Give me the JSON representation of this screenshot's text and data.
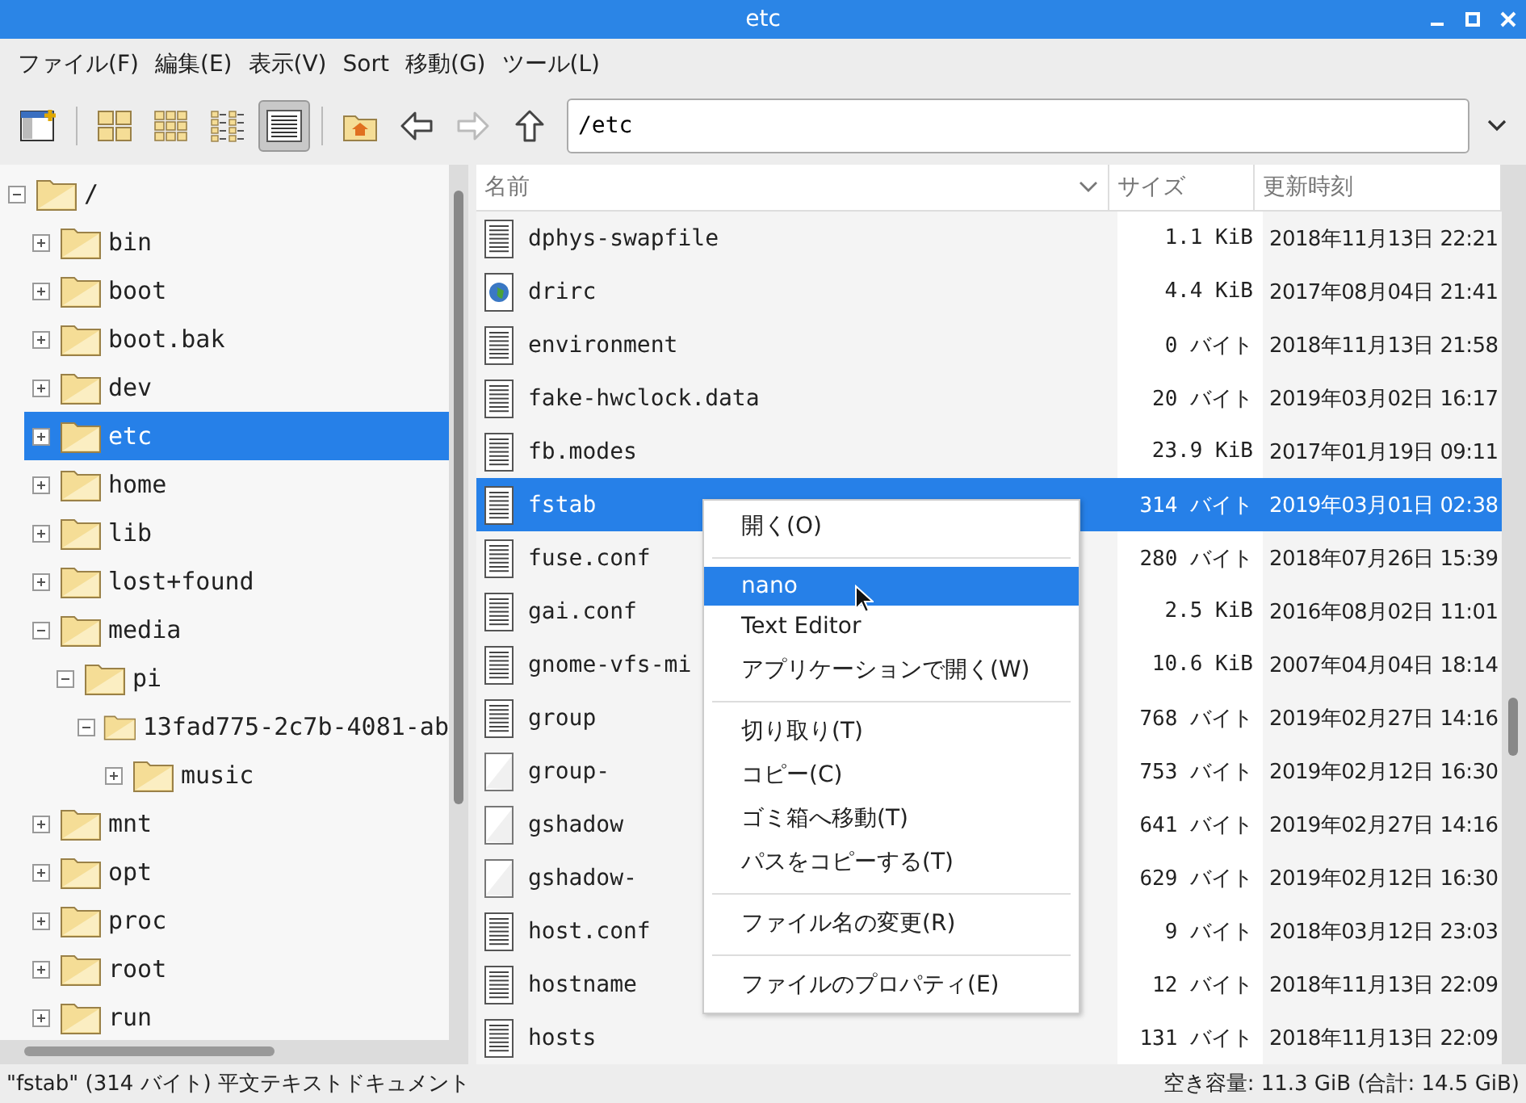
{
  "window": {
    "title": "etc"
  },
  "menu": [
    "ファイル(F)",
    "編集(E)",
    "表示(V)",
    "Sort",
    "移動(G)",
    "ツール(L)"
  ],
  "toolbar": {
    "views": [
      {
        "kind": "icons",
        "selected": false
      },
      {
        "kind": "thumbnails",
        "selected": false
      },
      {
        "kind": "compact",
        "selected": false
      },
      {
        "kind": "detail",
        "selected": true
      }
    ],
    "forward_disabled": true,
    "path": "/etc"
  },
  "tree": [
    {
      "label": "/",
      "expanded": true,
      "selected": false,
      "children": [
        {
          "label": "bin",
          "expanded": false,
          "selected": false
        },
        {
          "label": "boot",
          "expanded": false,
          "selected": false
        },
        {
          "label": "boot.bak",
          "expanded": false,
          "selected": false
        },
        {
          "label": "dev",
          "expanded": false,
          "selected": false
        },
        {
          "label": "etc",
          "expanded": false,
          "selected": true
        },
        {
          "label": "home",
          "expanded": false,
          "selected": false
        },
        {
          "label": "lib",
          "expanded": false,
          "selected": false
        },
        {
          "label": "lost+found",
          "expanded": false,
          "selected": false
        },
        {
          "label": "media",
          "expanded": true,
          "selected": false,
          "children": [
            {
              "label": "pi",
              "expanded": true,
              "selected": false,
              "children": [
                {
                  "label": "13fad775-2c7b-4081-ab",
                  "expanded": true,
                  "selected": false,
                  "children": [
                    {
                      "label": "music",
                      "expanded": false,
                      "selected": false
                    }
                  ]
                }
              ]
            }
          ]
        },
        {
          "label": "mnt",
          "expanded": false,
          "selected": false
        },
        {
          "label": "opt",
          "expanded": false,
          "selected": false
        },
        {
          "label": "proc",
          "expanded": false,
          "selected": false
        },
        {
          "label": "root",
          "expanded": false,
          "selected": false
        },
        {
          "label": "run",
          "expanded": false,
          "selected": false
        }
      ]
    }
  ],
  "table": {
    "columns": [
      "名前",
      "サイズ",
      "更新時刻"
    ],
    "rows": [
      {
        "kind": "text",
        "name": "dphys-swapfile",
        "size": "1.1 KiB",
        "modified": "2018年11月13日 22:21",
        "selected": false
      },
      {
        "kind": "globe",
        "name": "drirc",
        "size": "4.4 KiB",
        "modified": "2017年08月04日 21:41",
        "selected": false
      },
      {
        "kind": "text",
        "name": "environment",
        "size": "0 バイト",
        "modified": "2018年11月13日 21:58",
        "selected": false
      },
      {
        "kind": "text",
        "name": "fake-hwclock.data",
        "size": "20 バイト",
        "modified": "2019年03月02日 16:17",
        "selected": false
      },
      {
        "kind": "text",
        "name": "fb.modes",
        "size": "23.9 KiB",
        "modified": "2017年01月19日 09:11",
        "selected": false
      },
      {
        "kind": "text",
        "name": "fstab",
        "size": "314 バイト",
        "modified": "2019年03月01日 02:38",
        "selected": true
      },
      {
        "kind": "text",
        "name": "fuse.conf",
        "size": "280 バイト",
        "modified": "2018年07月26日 15:39",
        "selected": false
      },
      {
        "kind": "text",
        "name": "gai.conf",
        "size": "2.5 KiB",
        "modified": "2016年08月02日 11:01",
        "selected": false
      },
      {
        "kind": "text",
        "name": "gnome-vfs-mi",
        "size": "10.6 KiB",
        "modified": "2007年04月04日 18:14",
        "selected": false
      },
      {
        "kind": "text",
        "name": "group",
        "size": "768 バイト",
        "modified": "2019年02月27日 14:16",
        "selected": false
      },
      {
        "kind": "blank",
        "name": "group-",
        "size": "753 バイト",
        "modified": "2019年02月12日 16:30",
        "selected": false
      },
      {
        "kind": "blank",
        "name": "gshadow",
        "size": "641 バイト",
        "modified": "2019年02月27日 14:16",
        "selected": false
      },
      {
        "kind": "blank",
        "name": "gshadow-",
        "size": "629 バイト",
        "modified": "2019年02月12日 16:30",
        "selected": false
      },
      {
        "kind": "text",
        "name": "host.conf",
        "size": "9 バイト",
        "modified": "2018年03月12日 23:03",
        "selected": false
      },
      {
        "kind": "text",
        "name": "hostname",
        "size": "12 バイト",
        "modified": "2018年11月13日 22:09",
        "selected": false
      },
      {
        "kind": "text",
        "name": "hosts",
        "size": "131 バイト",
        "modified": "2018年11月13日 22:09",
        "selected": false
      }
    ]
  },
  "context_menu": [
    {
      "kind": "item",
      "label": "開く(O)",
      "selected": false
    },
    {
      "kind": "separator"
    },
    {
      "kind": "item",
      "label": "nano",
      "selected": true
    },
    {
      "kind": "item",
      "label": "Text Editor",
      "selected": false
    },
    {
      "kind": "item",
      "label": "アプリケーションで開く(W)",
      "selected": false
    },
    {
      "kind": "separator"
    },
    {
      "kind": "item",
      "label": "切り取り(T)",
      "selected": false
    },
    {
      "kind": "item",
      "label": "コピー(C)",
      "selected": false
    },
    {
      "kind": "item",
      "label": "ゴミ箱へ移動(T)",
      "selected": false
    },
    {
      "kind": "item",
      "label": "パスをコピーする(T)",
      "selected": false
    },
    {
      "kind": "separator"
    },
    {
      "kind": "item",
      "label": "ファイル名の変更(R)",
      "selected": false
    },
    {
      "kind": "separator"
    },
    {
      "kind": "item",
      "label": "ファイルのプロパティ(E)",
      "selected": false
    }
  ],
  "status_bar": {
    "left": "\"fstab\" (314 バイト) 平文テキストドキュメント",
    "right": "空き容量: 11.3 GiB (合計: 14.5 GiB)"
  }
}
